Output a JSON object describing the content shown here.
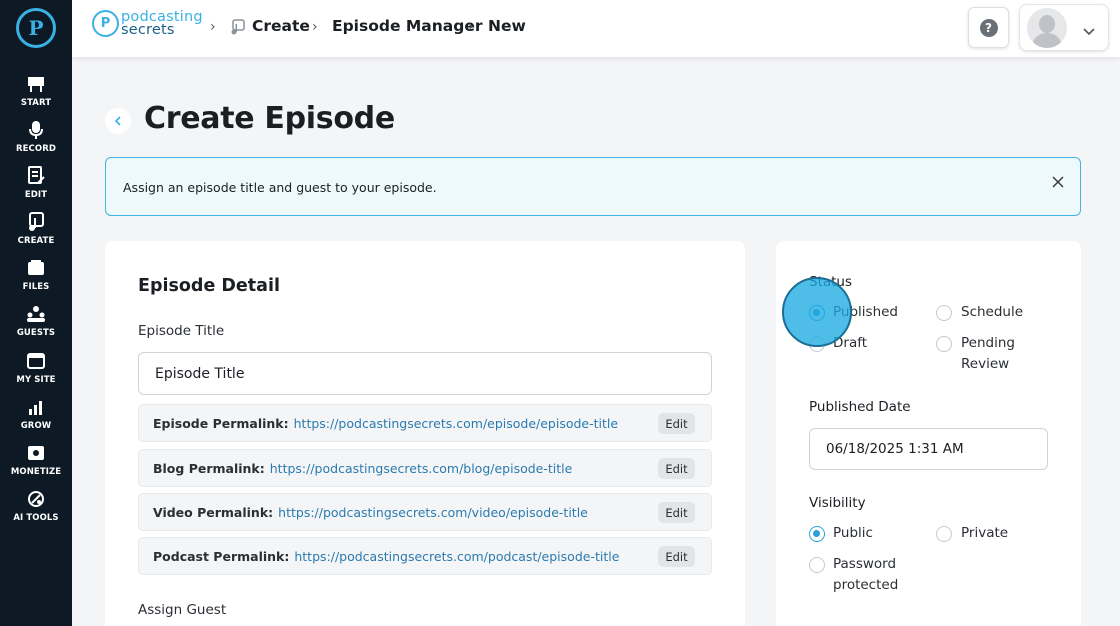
{
  "sidebar": {
    "items": [
      {
        "label": "START",
        "icon": "start-sign-icon"
      },
      {
        "label": "RECORD",
        "icon": "microphone-icon"
      },
      {
        "label": "EDIT",
        "icon": "edit-doc-icon"
      },
      {
        "label": "CREATE",
        "icon": "create-music-icon"
      },
      {
        "label": "FILES",
        "icon": "folder-icon"
      },
      {
        "label": "GUESTS",
        "icon": "guests-icon"
      },
      {
        "label": "MY SITE",
        "icon": "browser-icon"
      },
      {
        "label": "GROW",
        "icon": "bar-chart-icon"
      },
      {
        "label": "MONETIZE",
        "icon": "monetize-icon"
      },
      {
        "label": "AI TOOLS",
        "icon": "ai-tools-icon"
      }
    ]
  },
  "header": {
    "brand_line1": "podcasting",
    "brand_line2": "secrets",
    "breadcrumb": [
      "Create",
      "Episode Manager",
      "New"
    ],
    "help_label": "?"
  },
  "page": {
    "title": "Create Episode",
    "banner_text": "Assign an episode title and guest to your episode."
  },
  "episode_detail": {
    "heading": "Episode Detail",
    "title_label": "Episode Title",
    "title_value": "Episode Title",
    "permalinks": [
      {
        "label": "Episode Permalink:",
        "url": "https://podcastingsecrets.com/episode/episode-title",
        "edit": "Edit"
      },
      {
        "label": "Blog Permalink:",
        "url": "https://podcastingsecrets.com/blog/episode-title",
        "edit": "Edit"
      },
      {
        "label": "Video Permalink:",
        "url": "https://podcastingsecrets.com/video/episode-title",
        "edit": "Edit"
      },
      {
        "label": "Podcast Permalink:",
        "url": "https://podcastingsecrets.com/podcast/episode-title",
        "edit": "Edit"
      }
    ],
    "guest_label": "Assign Guest"
  },
  "status_panel": {
    "status_label": "Status",
    "status_options": [
      {
        "label": "Published",
        "selected": true
      },
      {
        "label": "Schedule",
        "selected": false
      },
      {
        "label": "Draft",
        "selected": false
      },
      {
        "label": "Pending Review",
        "selected": false
      }
    ],
    "published_date_label": "Published Date",
    "published_date_value": "06/18/2025 1:31 AM",
    "visibility_label": "Visibility",
    "visibility_options": [
      {
        "label": "Public",
        "selected": true
      },
      {
        "label": "Private",
        "selected": false
      },
      {
        "label": "Password protected",
        "selected": false
      }
    ]
  },
  "colors": {
    "sidebar_bg": "#0d1a26",
    "accent": "#3ab1e5",
    "link": "#2b7bb0"
  }
}
